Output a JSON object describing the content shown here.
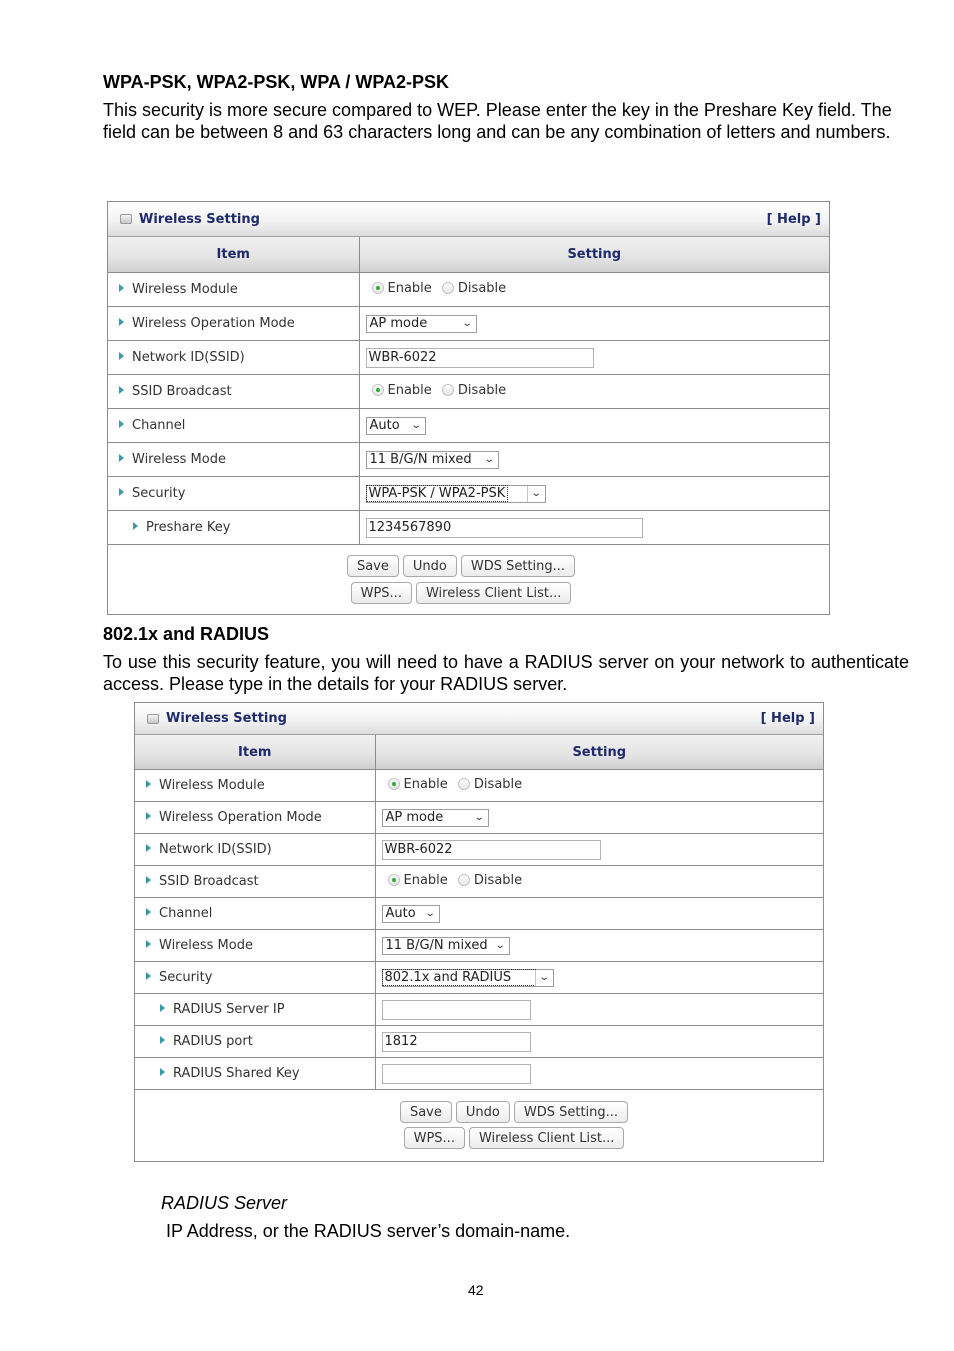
{
  "section1": {
    "heading": "WPA-PSK, WPA2-PSK, WPA / WPA2-PSK",
    "body": "This security is more secure compared to WEP. Please enter the key in the Preshare Key field. The field can be between 8 and 63 characters long and can be any combination of letters and numbers."
  },
  "panel1": {
    "title": "Wireless Setting",
    "help": "[ Help ]",
    "col_item": "Item",
    "col_setting": "Setting",
    "rows": {
      "wireless_module": {
        "label": "Wireless Module",
        "enable": "Enable",
        "disable": "Disable",
        "selected": "Enable"
      },
      "operation_mode": {
        "label": "Wireless Operation Mode",
        "value": "AP mode"
      },
      "ssid": {
        "label": "Network ID(SSID)",
        "value": "WBR-6022"
      },
      "ssid_broadcast": {
        "label": "SSID Broadcast",
        "enable": "Enable",
        "disable": "Disable",
        "selected": "Enable"
      },
      "channel": {
        "label": "Channel",
        "value": "Auto"
      },
      "wireless_mode": {
        "label": "Wireless Mode",
        "value": "11 B/G/N mixed"
      },
      "security": {
        "label": "Security",
        "value": "WPA-PSK / WPA2-PSK"
      },
      "preshare_key": {
        "label": "Preshare Key",
        "value": "1234567890"
      }
    },
    "buttons": {
      "save": "Save",
      "undo": "Undo",
      "wds": "WDS Setting...",
      "wps": "WPS...",
      "client_list": "Wireless Client List..."
    }
  },
  "section2": {
    "heading": "802.1x and RADIUS",
    "body": "To use this security feature, you will need to have a RADIUS server on your network to authenticate access. Please type in the details for your RADIUS server."
  },
  "panel2": {
    "title": "Wireless Setting",
    "help": "[ Help ]",
    "col_item": "Item",
    "col_setting": "Setting",
    "rows": {
      "wireless_module": {
        "label": "Wireless Module",
        "enable": "Enable",
        "disable": "Disable",
        "selected": "Enable"
      },
      "operation_mode": {
        "label": "Wireless Operation Mode",
        "value": "AP mode"
      },
      "ssid": {
        "label": "Network ID(SSID)",
        "value": "WBR-6022"
      },
      "ssid_broadcast": {
        "label": "SSID Broadcast",
        "enable": "Enable",
        "disable": "Disable",
        "selected": "Enable"
      },
      "channel": {
        "label": "Channel",
        "value": "Auto"
      },
      "wireless_mode": {
        "label": "Wireless Mode",
        "value": "11 B/G/N mixed"
      },
      "security": {
        "label": "Security",
        "value": "802.1x and RADIUS"
      },
      "radius_ip": {
        "label": "RADIUS Server IP",
        "value": ""
      },
      "radius_port": {
        "label": "RADIUS port",
        "value": "1812"
      },
      "radius_key": {
        "label": "RADIUS Shared Key",
        "value": ""
      }
    },
    "buttons": {
      "save": "Save",
      "undo": "Undo",
      "wds": "WDS Setting...",
      "wps": "WPS...",
      "client_list": "Wireless Client List..."
    }
  },
  "section3": {
    "term": "RADIUS Server",
    "definition": "IP Address, or the RADIUS server’s domain-name."
  },
  "page_number": "42"
}
